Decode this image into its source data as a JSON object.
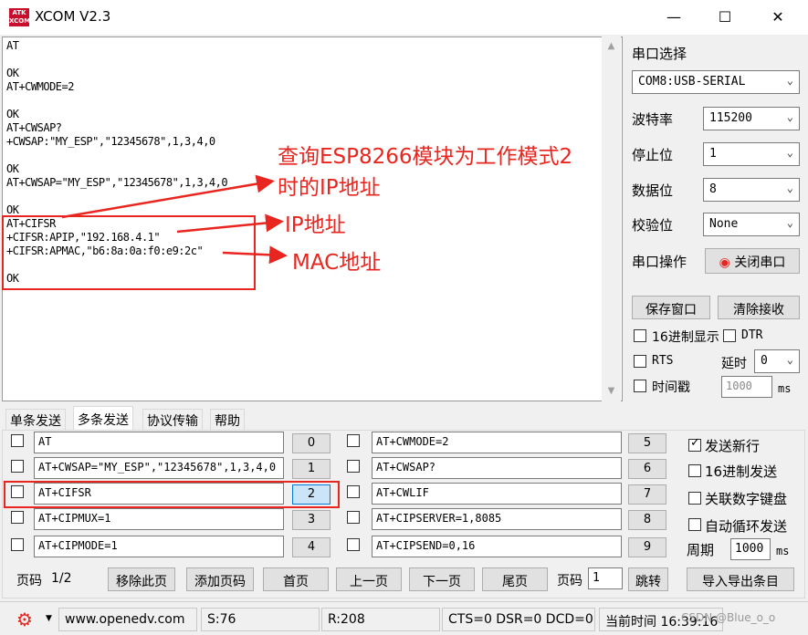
{
  "window": {
    "title": "XCOM V2.3",
    "logo_text": "ATK XCOM",
    "min_icon": "minimize-icon",
    "max_icon": "maximize-icon",
    "close_icon": "close-icon"
  },
  "receive_lines": [
    "AT",
    "",
    "OK",
    "AT+CWMODE=2",
    "",
    "OK",
    "AT+CWSAP?",
    "+CWSAP:\"MY_ESP\",\"12345678\",1,3,4,0",
    "",
    "OK",
    "AT+CWSAP=\"MY_ESP\",\"12345678\",1,3,4,0",
    "",
    "OK",
    "AT+CIFSR",
    "+CIFSR:APIP,\"192.168.4.1\"",
    "+CIFSR:APMAC,\"b6:8a:0a:f0:e9:2c\"",
    "",
    "OK"
  ],
  "annotations": {
    "line1": "查询ESP8266模块为工作模式2",
    "line2": "时的IP地址",
    "ip": "IP地址",
    "mac": "MAC地址",
    "color": "#e8251f"
  },
  "settings": {
    "port_select_label": "串口选择",
    "port_value": "COM8:USB-SERIAL",
    "baud_label": "波特率",
    "baud_value": "115200",
    "stopbits_label": "停止位",
    "stopbits_value": "1",
    "databits_label": "数据位",
    "databits_value": "8",
    "parity_label": "校验位",
    "parity_value": "None",
    "port_op_label": "串口操作",
    "close_port_label": "关闭串口",
    "save_window_label": "保存窗口",
    "clear_recv_label": "清除接收",
    "hex_display_label": "16进制显示",
    "dtr_label": "DTR",
    "rts_label": "RTS",
    "delay_label": "延时",
    "delay_value": "0",
    "timestamp_label": "时间戳",
    "timestamp_value": "1000",
    "ms_label": "ms"
  },
  "tabs": [
    "单条发送",
    "多条发送",
    "协议传输",
    "帮助"
  ],
  "multi_send": {
    "left": [
      {
        "text": "AT",
        "num": "0"
      },
      {
        "text": "AT+CWSAP=\"MY_ESP\",\"12345678\",1,3,4,0",
        "num": "1"
      },
      {
        "text": "AT+CIFSR",
        "num": "2"
      },
      {
        "text": "AT+CIPMUX=1",
        "num": "3"
      },
      {
        "text": "AT+CIPMODE=1",
        "num": "4"
      }
    ],
    "right": [
      {
        "text": "AT+CWMODE=2",
        "num": "5"
      },
      {
        "text": "AT+CWSAP?",
        "num": "6"
      },
      {
        "text": "AT+CWLIF",
        "num": "7"
      },
      {
        "text": "AT+CIPSERVER=1,8085",
        "num": "8"
      },
      {
        "text": "AT+CIPSEND=0,16",
        "num": "9"
      }
    ],
    "options": {
      "send_newline": "发送新行",
      "hex_send": "16进制发送",
      "keypad": "关联数字键盘",
      "auto_loop": "自动循环发送",
      "period_label": "周期",
      "period_value": "1000",
      "ms_label": "ms"
    },
    "page_label": "页码",
    "page_value": "1/2",
    "remove_page": "移除此页",
    "add_page": "添加页码",
    "first_page": "首页",
    "prev_page": "上一页",
    "next_page": "下一页",
    "last_page": "尾页",
    "page_goto_label": "页码",
    "page_goto_value": "1",
    "jump": "跳转",
    "import_export": "导入导出条目"
  },
  "status": {
    "url": "www.openedv.com",
    "sent": "S:76",
    "received": "R:208",
    "signals": "CTS=0 DSR=0 DCD=0",
    "time": "当前时间 16:39:16",
    "watermark": "CSDN @Blue_o_o"
  }
}
